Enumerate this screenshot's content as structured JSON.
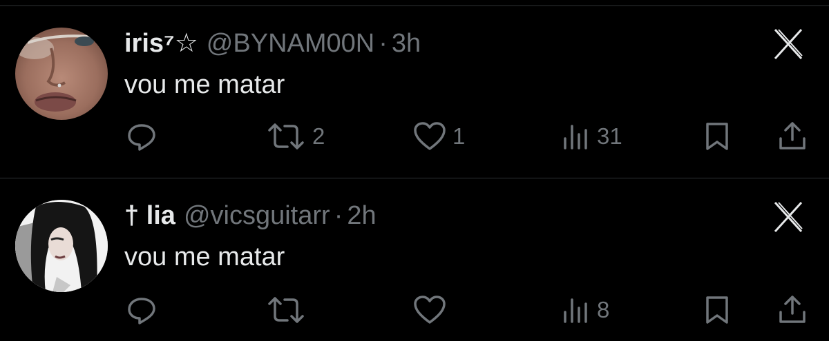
{
  "colors": {
    "background": "#000000",
    "text_primary": "#e7e9ea",
    "text_secondary": "#71767b",
    "divider": "#2f3336"
  },
  "tweets": [
    {
      "display_name": "iris⁷☆",
      "handle": "@BYNAM00N",
      "separator": "·",
      "time": "3h",
      "text": "vou me matar",
      "stats": {
        "replies": "",
        "reposts": "2",
        "likes": "1",
        "views": "31"
      },
      "icons": [
        "reply-icon",
        "repost-icon",
        "like-icon",
        "views-icon",
        "bookmark-icon",
        "share-icon",
        "grok-icon"
      ]
    },
    {
      "display_name": "† lia",
      "handle": "@vicsguitarr",
      "separator": "·",
      "time": "2h",
      "text": "vou me matar",
      "stats": {
        "replies": "",
        "reposts": "",
        "likes": "",
        "views": "8"
      },
      "icons": [
        "reply-icon",
        "repost-icon",
        "like-icon",
        "views-icon",
        "bookmark-icon",
        "share-icon",
        "grok-icon"
      ]
    }
  ]
}
